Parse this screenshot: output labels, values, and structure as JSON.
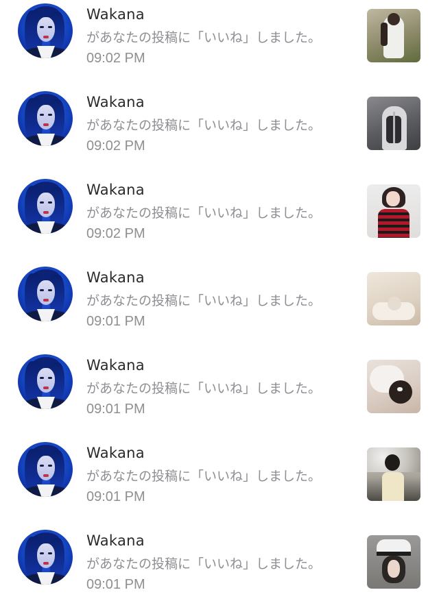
{
  "notifications": [
    {
      "user": "Wakana",
      "message": "があなたの投稿に「いいね」しました。",
      "time": "09:02 PM"
    },
    {
      "user": "Wakana",
      "message": "があなたの投稿に「いいね」しました。",
      "time": "09:02 PM"
    },
    {
      "user": "Wakana",
      "message": "があなたの投稿に「いいね」しました。",
      "time": "09:02 PM"
    },
    {
      "user": "Wakana",
      "message": "があなたの投稿に「いいね」しました。",
      "time": "09:01 PM"
    },
    {
      "user": "Wakana",
      "message": "があなたの投稿に「いいね」しました。",
      "time": "09:01 PM"
    },
    {
      "user": "Wakana",
      "message": "があなたの投稿に「いいね」しました。",
      "time": "09:01 PM"
    },
    {
      "user": "Wakana",
      "message": "があなたの投稿に「いいね」しました。",
      "time": "09:01 PM"
    }
  ],
  "colors": {
    "name_text": "#2a2a2a",
    "secondary_text": "#8e8e93",
    "avatar_blue": "#1848c8",
    "background": "#ffffff"
  }
}
